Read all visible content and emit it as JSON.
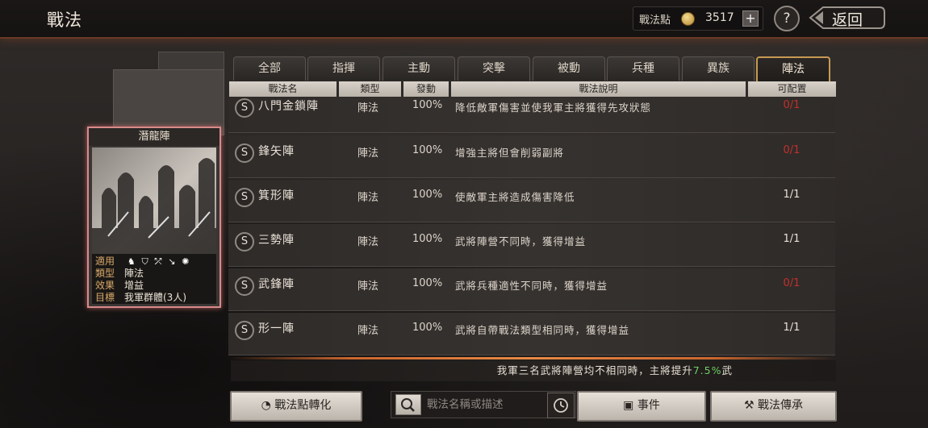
{
  "header": {
    "title": "戰法",
    "points_label": "戰法點",
    "points_value": "3517",
    "plus_label": "+",
    "help_label": "?",
    "back_label": "返回"
  },
  "card": {
    "name": "潛龍陣",
    "fields": [
      {
        "key": "適用",
        "value": ""
      },
      {
        "key": "類型",
        "value": "陣法"
      },
      {
        "key": "效果",
        "value": "增益"
      },
      {
        "key": "目標",
        "value": "我軍群體(3人)"
      }
    ],
    "suit_icons": [
      "cavalry-icon",
      "shield-icon",
      "bow-icon",
      "spear-icon",
      "wheel-icon"
    ]
  },
  "tabs": [
    {
      "label": "全部",
      "active": false
    },
    {
      "label": "指揮",
      "active": false
    },
    {
      "label": "主動",
      "active": false
    },
    {
      "label": "突擊",
      "active": false
    },
    {
      "label": "被動",
      "active": false
    },
    {
      "label": "兵種",
      "active": false
    },
    {
      "label": "異族",
      "active": false
    },
    {
      "label": "陣法",
      "active": true
    }
  ],
  "columns": [
    "戰法名",
    "類型",
    "發動",
    "戰法說明",
    "可配置"
  ],
  "rows": [
    {
      "grade": "S",
      "name": "八門金鎖陣",
      "type": "陣法",
      "rate": "100%",
      "desc": "降低敵軍傷害並使我軍主將獲得先攻狀態",
      "config": "0/1",
      "config_color": "#c2302b"
    },
    {
      "grade": "S",
      "name": "鋒矢陣",
      "type": "陣法",
      "rate": "100%",
      "desc": "增強主將但會削弱副將",
      "config": "0/1",
      "config_color": "#c2302b"
    },
    {
      "grade": "S",
      "name": "箕形陣",
      "type": "陣法",
      "rate": "100%",
      "desc": "使敵軍主將造成傷害降低",
      "config": "1/1",
      "config_color": "#e8e0d5"
    },
    {
      "grade": "S",
      "name": "三勢陣",
      "type": "陣法",
      "rate": "100%",
      "desc": "武將陣營不同時，獲得增益",
      "config": "1/1",
      "config_color": "#e8e0d5"
    },
    {
      "grade": "S",
      "name": "武鋒陣",
      "type": "陣法",
      "rate": "100%",
      "desc": "武將兵種適性不同時，獲得增益",
      "config": "0/1",
      "config_color": "#c2302b"
    },
    {
      "grade": "S",
      "name": "形一陣",
      "type": "陣法",
      "rate": "100%",
      "desc": "武將自帶戰法類型相同時，獲得增益",
      "config": "1/1",
      "config_color": "#e8e0d5"
    }
  ],
  "effect": {
    "prefix": "我軍三名武將陣營均不相同時，主將提升",
    "value": "7.5%",
    "suffix": "武"
  },
  "bottom": {
    "convert_label": "戰法點轉化",
    "search_placeholder": "戰法名稱或描述",
    "event_label": "事件",
    "inherit_label": "戰法傳承"
  },
  "colors": {
    "accent_gold": "#c79a52",
    "highlight_green": "#6fcf63",
    "config_red": "#c2302b"
  }
}
